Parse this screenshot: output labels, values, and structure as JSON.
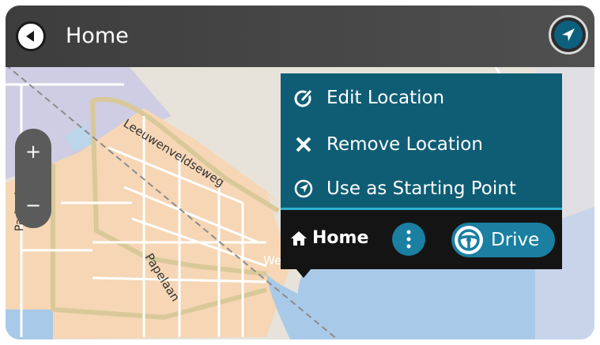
{
  "header": {
    "title": "Home"
  },
  "map_labels": {
    "street_1": "Leeuwenveldseweg",
    "street_2": "Papelaan",
    "street_3": "Parkuslaan",
    "place_partial": "We"
  },
  "zoom": {
    "in_label": "+",
    "out_label": "−"
  },
  "menu": {
    "items": [
      {
        "label": "Edit Location",
        "icon": "edit-icon"
      },
      {
        "label": "Remove Location",
        "icon": "close-icon"
      },
      {
        "label": "Use as Starting Point",
        "icon": "navigation-arrow-icon"
      }
    ]
  },
  "location_bar": {
    "name": "Home",
    "more_icon": "more-vertical-icon",
    "drive_label": "Drive",
    "drive_icon": "steering-wheel-icon"
  },
  "colors": {
    "panel_teal": "#0f5d74",
    "accent_blue": "#1a7fa0",
    "divider_cyan": "#2fb3d4",
    "header_gray": "#464646",
    "dark_bar": "#141414"
  }
}
